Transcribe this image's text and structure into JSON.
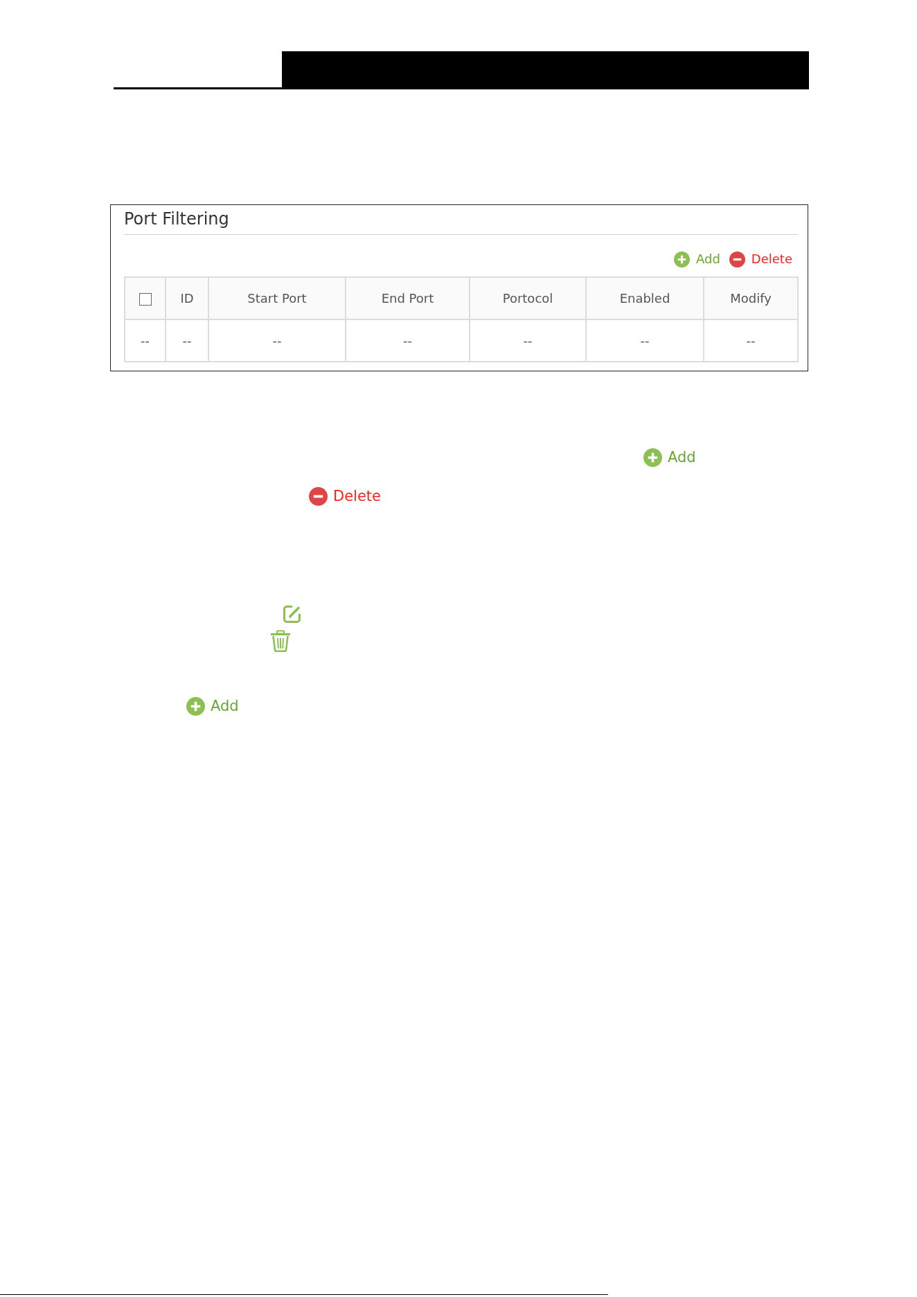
{
  "panel": {
    "title": "Port Filtering",
    "actions": [
      {
        "kind": "add",
        "label": "Add"
      },
      {
        "kind": "delete",
        "label": "Delete"
      }
    ],
    "table": {
      "columns": [
        {
          "kind": "checkbox",
          "checked": false
        },
        {
          "kind": "text",
          "label": "ID"
        },
        {
          "kind": "text",
          "label": "Start Port"
        },
        {
          "kind": "text",
          "label": "End Port"
        },
        {
          "kind": "text",
          "label": "Portocol"
        },
        {
          "kind": "text",
          "label": "Enabled"
        },
        {
          "kind": "text",
          "label": "Modify"
        }
      ],
      "rows": [
        {
          "cells": [
            "--",
            "--",
            "--",
            "--",
            "--",
            "--",
            "--"
          ]
        }
      ]
    }
  },
  "steps": [
    {
      "kind": "add",
      "label": "Add"
    },
    {
      "kind": "delete",
      "label": "Delete"
    },
    {
      "kind": "edit"
    },
    {
      "kind": "trash"
    },
    {
      "kind": "add",
      "label": "Add"
    }
  ]
}
